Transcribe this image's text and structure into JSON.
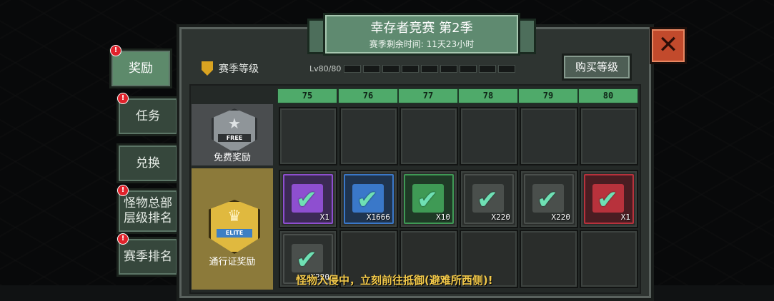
{
  "banner": {
    "title": "幸存者竞赛 第2季",
    "subtitle": "赛季剩余时间: 11天23小时"
  },
  "close": {
    "glyph": "✕"
  },
  "side_tabs": [
    {
      "label": "奖励",
      "active": true,
      "alert": true
    },
    {
      "label": "任务",
      "active": false,
      "alert": true
    },
    {
      "label": "兑换",
      "active": false,
      "alert": false
    },
    {
      "label": "怪物总部\n层级排名",
      "active": false,
      "alert": true
    },
    {
      "label": "赛季排名",
      "active": false,
      "alert": true
    }
  ],
  "alert_glyph": "!",
  "season": {
    "label": "赛季等级",
    "icon": "shield-icon",
    "level_text": "Lv80/80",
    "segments": 9
  },
  "buy_button": "购买等级",
  "levels": [
    "75",
    "76",
    "77",
    "78",
    "79",
    "80"
  ],
  "free_row": {
    "badge_text": "FREE",
    "star": "★",
    "label": "免费奖励"
  },
  "elite_row": {
    "badge_text": "ELITE",
    "wing": "♛",
    "label": "通行证奖励"
  },
  "check_glyph": "✔",
  "elite_rewards": [
    {
      "qty": "X1",
      "icon": "crate-icon",
      "color": "#8e4fd0",
      "bg": "#3c2a55"
    },
    {
      "qty": "X1666",
      "icon": "gear-plate-icon",
      "color": "#3a78c9",
      "bg": "#1f344f"
    },
    {
      "qty": "X10",
      "icon": "wrench-icon",
      "color": "#3f9a55",
      "bg": "#1f3a26"
    },
    {
      "qty": "X220",
      "icon": "ammo-box-icon",
      "color": "#4a4f4c",
      "bg": "#2c302e"
    },
    {
      "qty": "X220",
      "icon": "ammo-box-icon",
      "color": "#4a4f4c",
      "bg": "#2c302e"
    },
    {
      "qty": "X1",
      "icon": "red-gem-icon",
      "color": "#b8323c",
      "bg": "#4a1d22"
    }
  ],
  "elite_row2": [
    {
      "qty": "X220",
      "icon": "ammo-box-icon",
      "color": "#4a4f4c",
      "bg": "#2c302e"
    }
  ],
  "ticker": "怪物入侵中，立刻前往抵御(避难所西侧)!"
}
